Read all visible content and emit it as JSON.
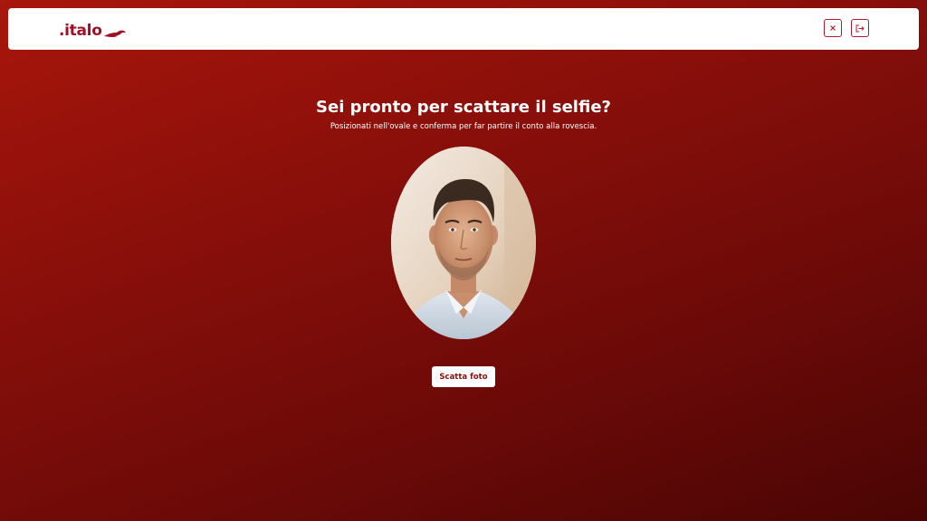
{
  "header": {
    "logo_text": ".italo",
    "close_icon": "close-icon",
    "exit_icon": "logout-icon"
  },
  "main": {
    "title": "Sei pronto per scattare il selfie?",
    "subtitle": "Posizionati nell'ovale e conferma per far partire il conto alla rovescia.",
    "shoot_button_label": "Scatta foto"
  },
  "colors": {
    "brand": "#a10f24",
    "background_start": "#a8160c",
    "background_end": "#4a0504"
  }
}
